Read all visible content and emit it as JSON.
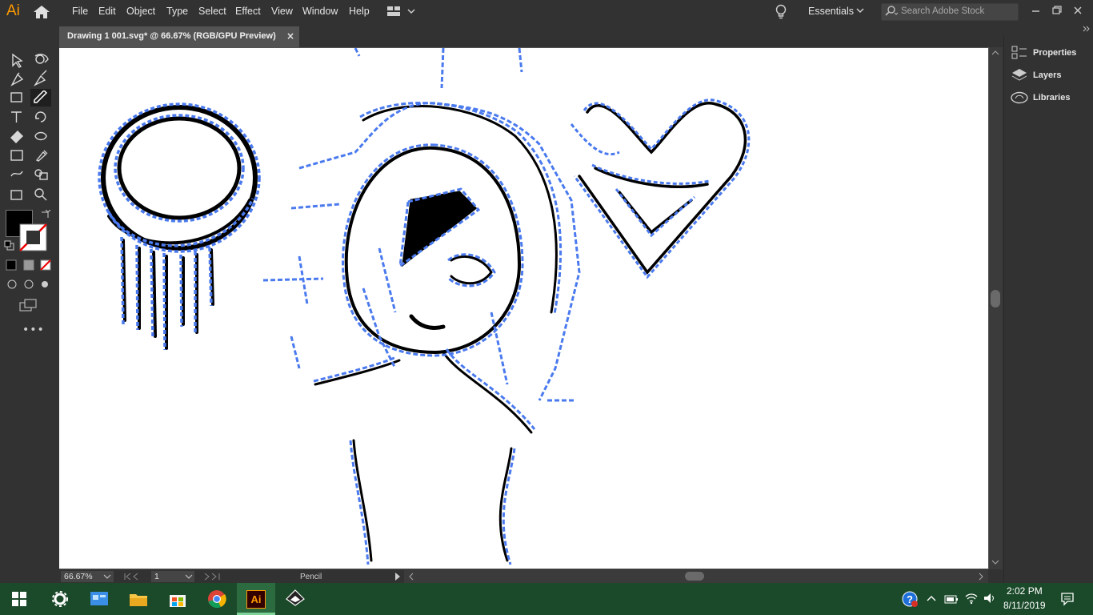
{
  "app": {
    "logo": "Ai"
  },
  "menu": [
    "File",
    "Edit",
    "Object",
    "Type",
    "Select",
    "Effect",
    "View",
    "Window",
    "Help"
  ],
  "workspace": {
    "label": "Essentials"
  },
  "search": {
    "placeholder": "Search Adobe Stock"
  },
  "document": {
    "tab_title": "Drawing 1 001.svg* @ 66.67% (RGB/GPU Preview)",
    "close_glyph": "×"
  },
  "panels": [
    "Properties",
    "Layers",
    "Libraries"
  ],
  "status": {
    "zoom": "66.67%",
    "artboard": "1",
    "current_tool": "Pencil"
  },
  "colors": {
    "ui_bg": "#323232",
    "accent": "#ff9a00",
    "path_selection": "#4a7aee",
    "taskbar": "#1b4a2a"
  },
  "taskbar": {
    "apps": [
      "settings-icon",
      "control-panel-icon",
      "file-explorer-icon",
      "store-icon",
      "chrome-icon",
      "illustrator-icon",
      "inkscape-icon"
    ],
    "time": "2:02 PM",
    "date": "8/11/2019"
  }
}
